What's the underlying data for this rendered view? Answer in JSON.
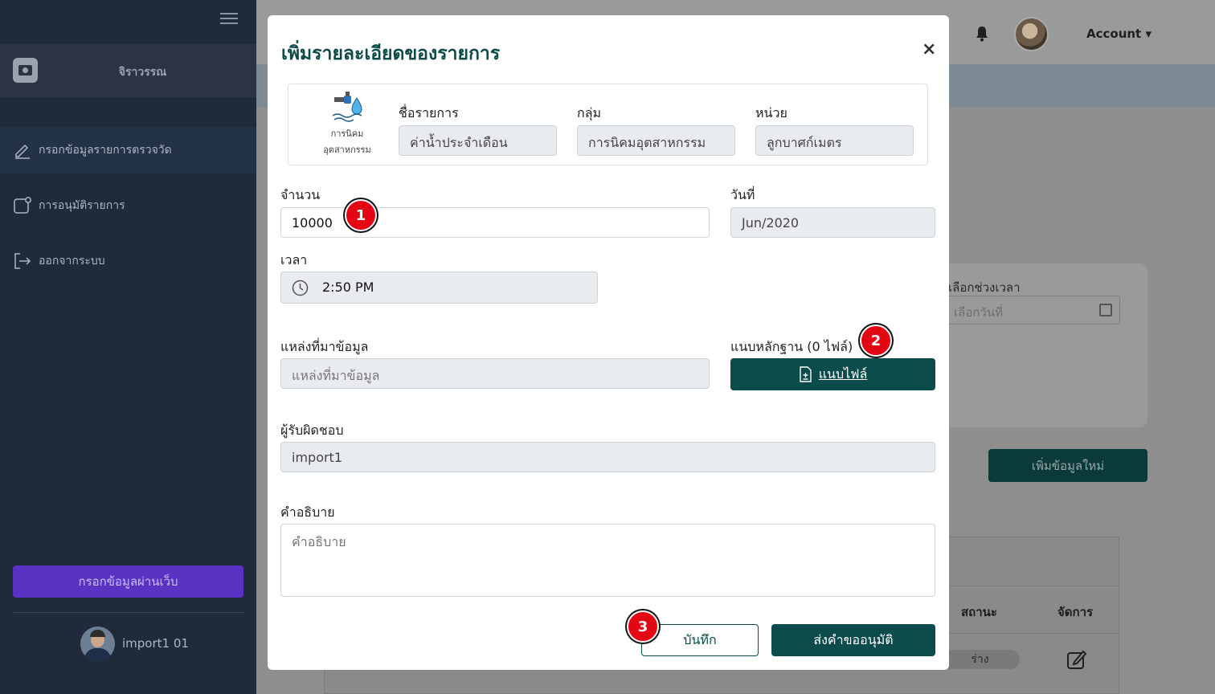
{
  "sidebar": {
    "username": "จิราวรรณ",
    "items": [
      {
        "label": "กรอกข้อมูลรายการตรวจวัด",
        "icon": "edit-icon"
      },
      {
        "label": "การอนุมัติรายการ",
        "icon": "notification-icon"
      },
      {
        "label": "ออกจากระบบ",
        "icon": "logout-icon"
      }
    ],
    "web_button": "กรอกข้อมูลผ่านเว็บ",
    "user_name": "import1 01"
  },
  "header": {
    "account_label": "Account ▾"
  },
  "background": {
    "date_range_label": "เลือกช่วงเวลา",
    "date_placeholder": "เลือกวันที่",
    "add_button": "เพิ่มข้อมูลใหม่",
    "table_headers": [
      "สถานะ",
      "จัดการ"
    ],
    "status_badge": "ร่าง"
  },
  "modal": {
    "title": "เพิ่มรายละเอียดของรายการ",
    "close": "×",
    "category_line1": "การนิคม",
    "category_line2": "อุตสาหกรรม",
    "item_name_label": "ชื่อรายการ",
    "item_name_value": "ค่าน้ำประจำเดือน",
    "group_label": "กลุ่ม",
    "group_value": "การนิคมอุตสาหกรรม",
    "unit_label": "หน่วย",
    "unit_value": "ลูกบาศก์เมตร",
    "amount_label": "จำนวน",
    "amount_value": "10000",
    "date_label": "วันที่",
    "date_value": "Jun/2020",
    "time_label": "เวลา",
    "time_value": "2:50 PM",
    "source_label": "แหล่งที่มาข้อมูล",
    "source_placeholder": "แหล่งที่มาข้อมูล",
    "evidence_label": "แนบหลักฐาน (0 ไฟล์)",
    "attach_button": "แนบไฟล์",
    "responsible_label": "ผู้รับผิดชอบ",
    "responsible_value": "import1",
    "description_label": "คำอธิบาย",
    "description_placeholder": "คำอธิบาย",
    "save_button": "บันทึก",
    "submit_button": "ส่งคำขออนุมัติ"
  },
  "annotations": {
    "marker_1": "1",
    "marker_2": "2",
    "marker_3": "3"
  },
  "colors": {
    "sidebar_bg": "#1f2a3a",
    "primary": "#0b4b4b",
    "purple": "#5a33c4",
    "marker": "#e30613"
  }
}
